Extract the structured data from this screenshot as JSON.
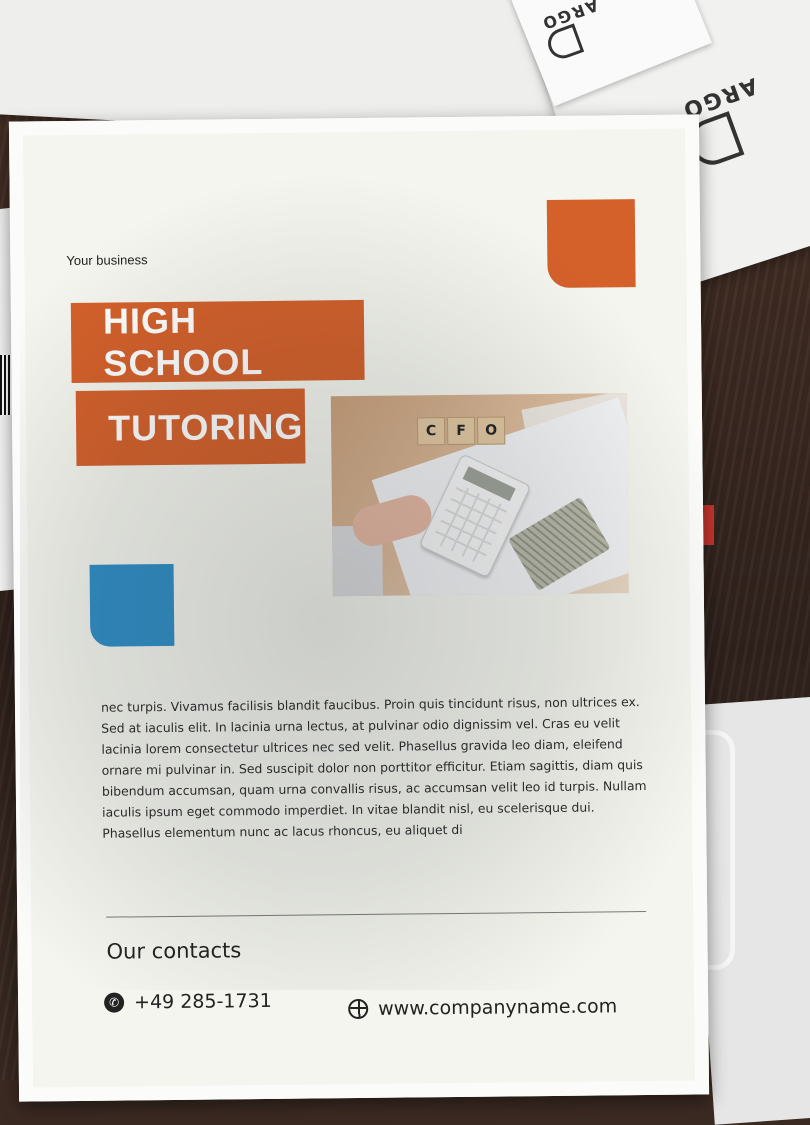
{
  "flyer": {
    "brand": "Your business",
    "title_line1": "HIGH SCHOOL",
    "title_line2": "TUTORING",
    "photo_tiles": [
      "C",
      "F",
      "O"
    ],
    "body": "nec turpis. Vivamus facilisis blandit faucibus. Proin quis tincidunt risus, non ultrices ex. Sed at iaculis elit. In lacinia urna lectus, at pulvinar odio dignissim vel. Cras eu velit lacinia lorem consectetur ultrices nec sed velit. Phasellus gravida leo diam, eleifend ornare mi pulvinar in. Sed suscipit dolor non porttitor efficitur. Etiam sagittis, diam quis bibendum accumsan, quam urna convallis risus, ac accumsan velit leo id turpis. Nullam iaculis ipsum eget commodo imperdiet. In vitae blandit nisl, eu scelerisque dui. Phasellus elementum nunc ac lacus rhoncus, eu aliquet di",
    "contacts_heading": "Our contacts",
    "phone": "+49 285-1731",
    "website": "www.companyname.com"
  },
  "background": {
    "envelope_logo": "ARGO"
  },
  "colors": {
    "orange": "#d4602a",
    "blue": "#2f8ec6",
    "paper": "#f4f5ee",
    "desk": "#3b2a22"
  },
  "icons": {
    "phone": "phone-icon",
    "web": "globe-icon"
  }
}
